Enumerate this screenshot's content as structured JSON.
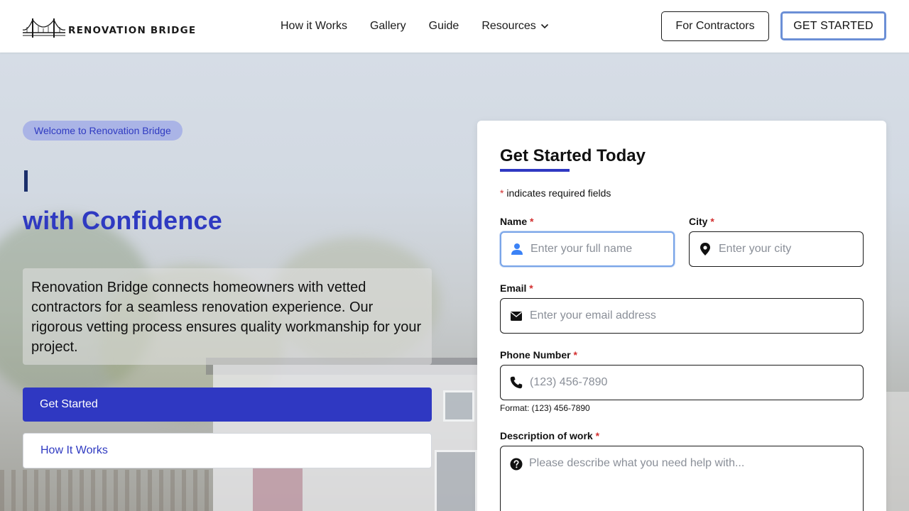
{
  "brand": {
    "name": "RENOVATION BRIDGE"
  },
  "nav": {
    "items": [
      {
        "label": "How it Works"
      },
      {
        "label": "Gallery"
      },
      {
        "label": "Guide"
      },
      {
        "label": "Resources"
      }
    ],
    "contractors_label": "For Contractors",
    "get_started_label": "GET STARTED"
  },
  "hero": {
    "badge": "Welcome to Renovation Bridge",
    "headline": "with Confidence",
    "description": "Renovation Bridge connects homeowners with vetted contractors for a seamless renovation experience. Our rigorous vetting process ensures quality workmanship for your project.",
    "primary_button": "Get Started",
    "secondary_button": "How It Works"
  },
  "form": {
    "title": "Get Started Today",
    "required_note_star": "*",
    "required_note": " indicates required fields",
    "fields": {
      "name": {
        "label": "Name",
        "placeholder": "Enter your full name",
        "icon": "user-icon"
      },
      "city": {
        "label": "City",
        "placeholder": "Enter your city",
        "icon": "location-pin-icon"
      },
      "email": {
        "label": "Email",
        "placeholder": "Enter your email address",
        "icon": "envelope-icon"
      },
      "phone": {
        "label": "Phone Number",
        "placeholder": "(123) 456-7890",
        "icon": "phone-icon",
        "hint": "Format: (123) 456-7890"
      },
      "description": {
        "label": "Description of work",
        "placeholder": "Please describe what you need help with...",
        "icon": "question-circle-icon"
      }
    },
    "required_star": "*"
  },
  "colors": {
    "accent": "#2f38c2",
    "badge_bg": "#aab4e6",
    "focus_border": "#7aa5e8",
    "required": "#d32f2f"
  }
}
